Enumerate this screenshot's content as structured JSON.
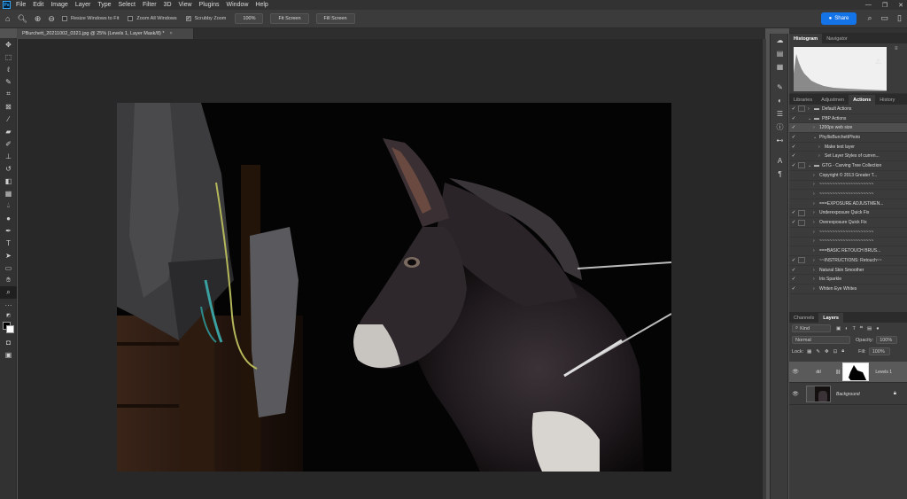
{
  "app": {
    "logo": "Ps"
  },
  "menu": [
    "File",
    "Edit",
    "Image",
    "Layer",
    "Type",
    "Select",
    "Filter",
    "3D",
    "View",
    "Plugins",
    "Window",
    "Help"
  ],
  "options": {
    "resize_windows": "Resize Windows to Fit",
    "zoom_all": "Zoom All Windows",
    "scrubby_zoom": "Scrubby Zoom",
    "zoom_100": "100%",
    "fit_screen": "Fit Screen",
    "fill_screen": "Fill Screen",
    "share": "Share"
  },
  "document": {
    "tab_title": "PBurchett_20211002_0321.jpg @ 25% (Levels 1, Layer Mask/8) *"
  },
  "histogram_panel": {
    "tabs": [
      "Histogram",
      "Navigator"
    ],
    "active_tab": "Histogram",
    "warning_icon": "warning-icon"
  },
  "actions_panel": {
    "tabs": [
      "Libraries",
      "Adjustmen",
      "Actions",
      "History"
    ],
    "active_tab": "Actions",
    "rows": [
      {
        "label": "Default Actions",
        "check": "✓",
        "dialog": true,
        "tri": "›",
        "folder": true,
        "indent": 0
      },
      {
        "label": "PBP Actions",
        "check": "✓",
        "dialog": false,
        "tri": "⌄",
        "folder": true,
        "indent": 0
      },
      {
        "label": "1200px web size",
        "check": "✓",
        "dialog": false,
        "tri": "›",
        "folder": false,
        "indent": 1,
        "selected": true
      },
      {
        "label": "PhyllisBurchettPhoto",
        "check": "✓",
        "dialog": false,
        "tri": "⌄",
        "folder": false,
        "indent": 1
      },
      {
        "label": "Make text layer",
        "check": "✓",
        "dialog": false,
        "tri": "›",
        "folder": false,
        "indent": 2
      },
      {
        "label": "Set Layer Styles of curren...",
        "check": "✓",
        "dialog": false,
        "tri": "›",
        "folder": false,
        "indent": 2
      },
      {
        "label": "GTG - Carving Tree Collection",
        "check": "✓",
        "dialog": true,
        "tri": "⌄",
        "folder": true,
        "indent": 0
      },
      {
        "label": "Copyright © 2013 Greater T...",
        "check": "",
        "dialog": false,
        "tri": "›",
        "folder": false,
        "indent": 1
      },
      {
        "label": "~~~~~~~~~~~~~~~~~~~~~",
        "check": "",
        "dialog": false,
        "tri": "›",
        "folder": false,
        "indent": 1
      },
      {
        "label": "~~~~~~~~~~~~~~~~~~~~~",
        "check": "",
        "dialog": false,
        "tri": "›",
        "folder": false,
        "indent": 1
      },
      {
        "label": "===EXPOSURE ADJUSTMEN...",
        "check": "",
        "dialog": false,
        "tri": "›",
        "folder": false,
        "indent": 1
      },
      {
        "label": "Underexposure Quick Fix",
        "check": "✓",
        "dialog": true,
        "tri": "›",
        "folder": false,
        "indent": 1
      },
      {
        "label": "Overexposure Quick Fix",
        "check": "✓",
        "dialog": true,
        "tri": "›",
        "folder": false,
        "indent": 1
      },
      {
        "label": "~~~~~~~~~~~~~~~~~~~~~",
        "check": "",
        "dialog": false,
        "tri": "›",
        "folder": false,
        "indent": 1
      },
      {
        "label": "~~~~~~~~~~~~~~~~~~~~~",
        "check": "",
        "dialog": false,
        "tri": "›",
        "folder": false,
        "indent": 1
      },
      {
        "label": "===BASIC RETOUCH BRUS...",
        "check": "",
        "dialog": false,
        "tri": "›",
        "folder": false,
        "indent": 1
      },
      {
        "label": "~~INSTRUCTIONS: Retouch~~",
        "check": "✓",
        "dialog": true,
        "tri": "›",
        "folder": false,
        "indent": 1
      },
      {
        "label": "Natural Skin Smoother",
        "check": "✓",
        "dialog": false,
        "tri": "›",
        "folder": false,
        "indent": 1
      },
      {
        "label": "Iris Sparkle",
        "check": "✓",
        "dialog": false,
        "tri": "›",
        "folder": false,
        "indent": 1
      },
      {
        "label": "Whiten Eye Whites",
        "check": "✓",
        "dialog": false,
        "tri": "›",
        "folder": false,
        "indent": 1
      }
    ],
    "footer_icons": [
      "stop-icon",
      "record-icon",
      "play-icon",
      "new-set-icon",
      "new-action-icon",
      "delete-icon"
    ]
  },
  "layers_panel": {
    "tabs": [
      "Channels",
      "Layers"
    ],
    "active_tab": "Layers",
    "filter_kind": "Kind",
    "blend_mode": "Normal",
    "opacity_label": "Opacity:",
    "opacity_value": "100%",
    "lock_label": "Lock:",
    "fill_label": "Fill:",
    "fill_value": "100%",
    "layers": [
      {
        "name": "Levels 1",
        "type": "adjustment",
        "selected": true
      },
      {
        "name": "Background",
        "type": "image",
        "selected": false
      }
    ]
  },
  "tools": [
    "move-tool-icon",
    "marquee-tool-icon",
    "lasso-tool-icon",
    "quick-select-tool-icon",
    "crop-tool-icon",
    "frame-tool-icon",
    "eyedropper-tool-icon",
    "healing-brush-tool-icon",
    "brush-tool-icon",
    "clone-stamp-tool-icon",
    "history-brush-tool-icon",
    "eraser-tool-icon",
    "gradient-tool-icon",
    "blur-tool-icon",
    "dodge-tool-icon",
    "pen-tool-icon",
    "type-tool-icon",
    "path-select-tool-icon",
    "shape-tool-icon",
    "hand-tool-icon",
    "zoom-tool-icon",
    "more-tools-icon"
  ],
  "colors": {
    "accent": "#1473e6",
    "bg_dark": "#282828",
    "panel": "#3b3b3b"
  }
}
